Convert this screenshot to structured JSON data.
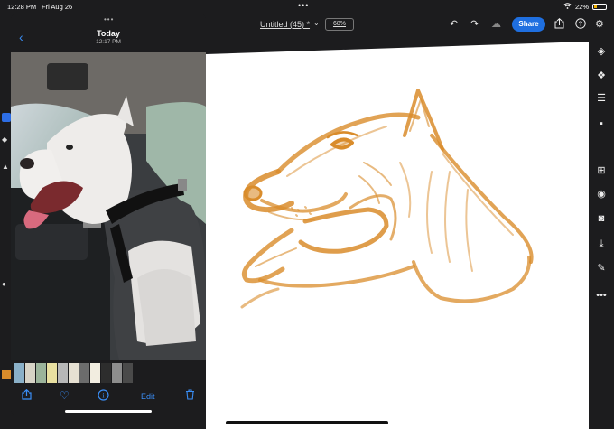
{
  "status": {
    "time": "12:28 PM",
    "date": "Fri Aug 26",
    "battery": "22%",
    "wifi_icon": "wifi-icon",
    "more_icon": "more-dots-icon"
  },
  "toolbar": {
    "doc_title": "Untitled (45) *",
    "zoom": "68%",
    "share_label": "Share",
    "icons": [
      "undo-icon",
      "redo-icon",
      "cloud-icon",
      "export-icon",
      "help-icon",
      "gear-icon"
    ]
  },
  "photos_app": {
    "title": "Today",
    "subtitle": "12:17 PM",
    "edit_label": "Edit",
    "thumbnail_count": 11
  },
  "right_rail": {
    "icons": [
      "layers-icon",
      "add-layer-icon",
      "adjust-icon",
      "comment-icon",
      "plus-square-icon",
      "eye-icon",
      "mask-icon",
      "import-icon",
      "brush-settings-icon",
      "more-icon"
    ]
  },
  "colors": {
    "accent": "#1f6fe0",
    "sketch": "#d98c2b",
    "ios_blue": "#3a8ef6"
  }
}
